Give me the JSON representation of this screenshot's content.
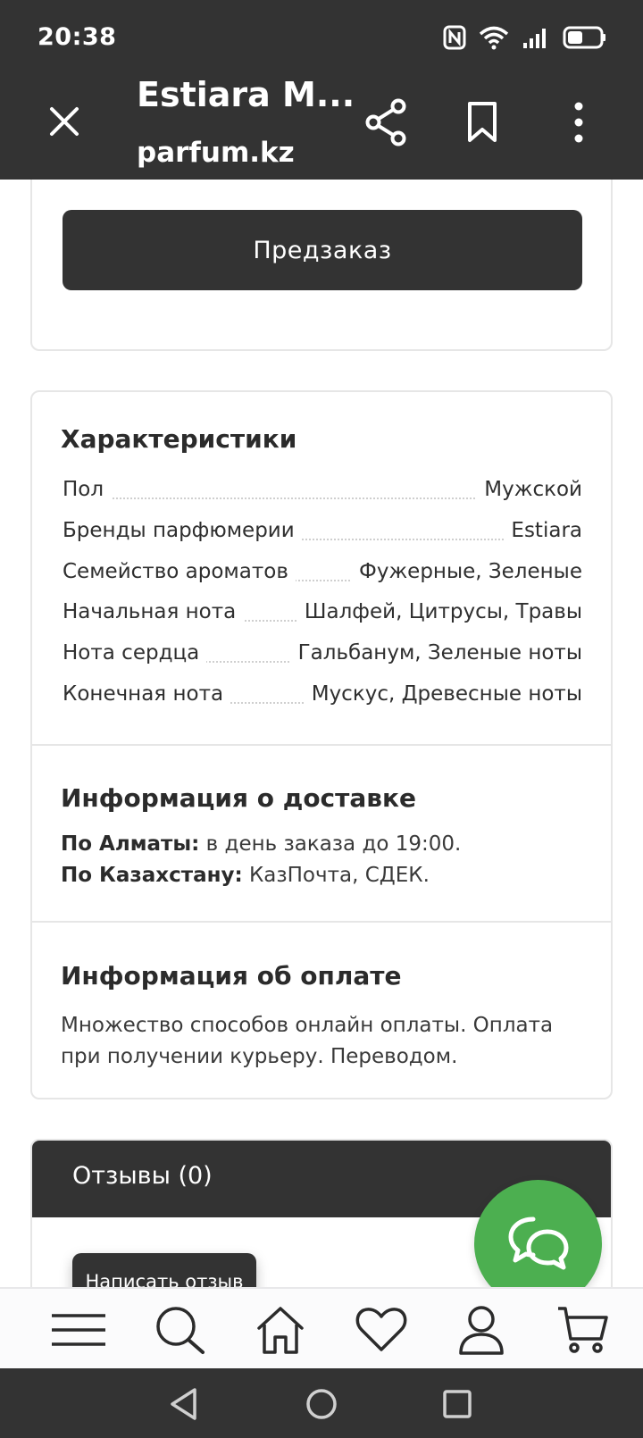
{
  "status_bar": {
    "time": "20:38"
  },
  "tab_header": {
    "title": "Estiara M...",
    "url": "parfum.kz"
  },
  "product_actions": {
    "preorder_label": "Предзаказ"
  },
  "characteristics": {
    "title": "Характеристики",
    "rows": [
      {
        "label": "Пол",
        "value": "Мужской"
      },
      {
        "label": "Бренды парфюмерии",
        "value": "Estiara"
      },
      {
        "label": "Семейство ароматов",
        "value": "Фужерные, Зеленые"
      },
      {
        "label": "Начальная нота",
        "value": "Шалфей, Цитрусы, Травы"
      },
      {
        "label": "Нота сердца",
        "value": "Гальбанум, Зеленые ноты"
      },
      {
        "label": "Конечная нота",
        "value": "Мускус, Древесные ноты"
      }
    ]
  },
  "delivery": {
    "title": "Информация о доставке",
    "lines": [
      {
        "label": "По Алматы:",
        "text": " в день заказа до 19:00."
      },
      {
        "label": "По Казахстану:",
        "text": " КазПочта, СДЕК."
      }
    ]
  },
  "payment": {
    "title": "Информация об оплате",
    "text": "Множество способов онлайн оплаты. Оплата при получении курьеру. Переводом."
  },
  "reviews": {
    "title": "Отзывы (0)",
    "write_review_label": "Написать отзыв"
  },
  "colors": {
    "dark": "#333333",
    "accent_green": "#4caf50",
    "border": "#e6e6e6"
  },
  "icons": {
    "close": "close-icon",
    "share": "share-icon",
    "bookmark": "bookmark-icon",
    "more": "more-vertical-icon",
    "chat": "chat-bubbles-icon",
    "nav": [
      "menu-icon",
      "search-icon",
      "home-icon",
      "heart-icon",
      "user-icon",
      "cart-icon"
    ]
  }
}
